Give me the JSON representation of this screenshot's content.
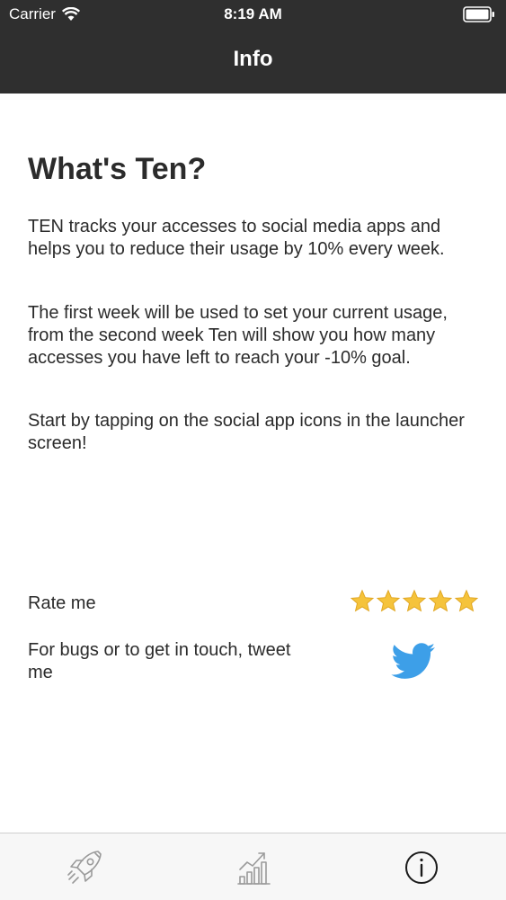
{
  "status_bar": {
    "carrier": "Carrier",
    "time": "8:19 AM",
    "icons": [
      "wifi-icon",
      "battery-icon"
    ]
  },
  "nav": {
    "title": "Info"
  },
  "content": {
    "heading": "What's Ten?",
    "paragraphs": [
      "TEN tracks your accesses to social media apps and helps you to reduce their usage by 10% every week.",
      "The first week will be used to set your current usage, from the second week Ten will show you how many accesses you have left to reach your -10% goal.",
      "Start by tapping on the social app icons in the launcher screen!"
    ]
  },
  "rate": {
    "label": "Rate me",
    "stars": 5,
    "icon": "star-icon",
    "star_color": "#f5c33b"
  },
  "tweet": {
    "label": "For bugs or to get in touch, tweet me",
    "icon": "twitter-icon",
    "color": "#3d9fe8"
  },
  "tab_bar": {
    "tabs": [
      {
        "icon": "rocket-icon",
        "selected": false
      },
      {
        "icon": "bar-chart-icon",
        "selected": false
      },
      {
        "icon": "info-icon",
        "selected": true
      }
    ]
  },
  "colors": {
    "bar_background": "#2f2f2f",
    "text": "#2b2b2b",
    "tab_inactive": "#9a9a9a",
    "tab_active": "#1a1a1a"
  }
}
